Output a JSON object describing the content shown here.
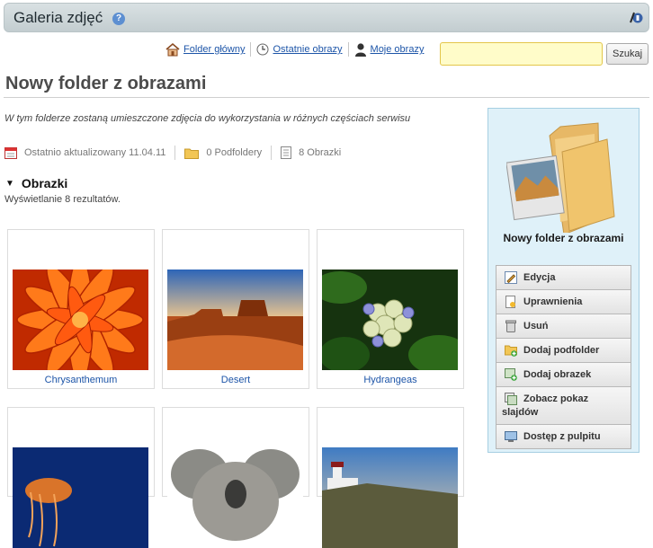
{
  "header": {
    "title": "Galeria zdjęć",
    "help_glyph": "?"
  },
  "nav": {
    "links": [
      "Folder główny",
      "Ostatnie obrazy",
      "Moje obrazy"
    ],
    "search_value": "",
    "search_button": "Szukaj"
  },
  "page": {
    "title": "Nowy folder z obrazami",
    "description": "W tym folderze zostaną umieszczone zdjęcia do wykorzystania w różnych częściach serwisu",
    "meta": {
      "updated": "Ostatnio aktualizowany 11.04.11",
      "subfolders": "0 Podfoldery",
      "images": "8 Obrazki"
    }
  },
  "gallery": {
    "heading": "Obrazki",
    "toggle": "▼",
    "results": "Wyświetlanie 8 rezultatów.",
    "items": [
      "Chrysanthemum",
      "Desert",
      "Hydrangeas",
      "",
      "",
      ""
    ]
  },
  "panel": {
    "folder_name": "Nowy folder z obrazami",
    "actions": [
      "Edycja",
      "Uprawnienia",
      "Usuń",
      "Dodaj podfolder",
      "Dodaj obrazek",
      "Zobacz pokaz slajdów",
      "Dostęp z pulpitu"
    ]
  }
}
